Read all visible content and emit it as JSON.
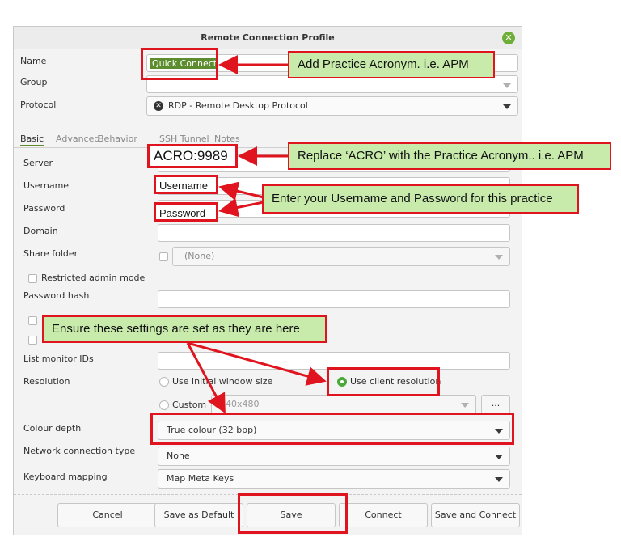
{
  "window": {
    "title": "Remote Connection Profile"
  },
  "form": {
    "name_label": "Name",
    "name_value": "Quick Connect",
    "group_label": "Group",
    "protocol_label": "Protocol",
    "protocol_value": "RDP - Remote Desktop Protocol"
  },
  "tabs": [
    "Basic",
    "Advanced",
    "Behavior",
    "SSH Tunnel",
    "Notes"
  ],
  "basic": {
    "server_label": "Server",
    "server_value": "ACRO:9989",
    "username_label": "Username",
    "username_value": "Username",
    "password_label": "Password",
    "password_value": "Password",
    "domain_label": "Domain",
    "share_label": "Share folder",
    "share_value": "(None)",
    "restricted_label": "Restricted admin mode",
    "hash_label": "Password hash",
    "monitor_label": "List monitor IDs",
    "resolution_label": "Resolution",
    "use_initial_label": "Use initial window size",
    "use_client_label": "Use client resolution",
    "custom_label": "Custom",
    "custom_value": "640x480",
    "custom_more": "...",
    "colour_label": "Colour depth",
    "colour_value": "True colour (32 bpp)",
    "network_label": "Network connection type",
    "network_value": "None",
    "keyboard_label": "Keyboard mapping",
    "keyboard_value": "Map Meta Keys"
  },
  "buttons": {
    "cancel": "Cancel",
    "save_default": "Save as Default",
    "save": "Save",
    "connect": "Connect",
    "save_connect": "Save and Connect"
  },
  "annotations": {
    "acronym": "Add Practice Acronym. i.e. APM",
    "replace": "Replace ‘ACRO’ with the Practice Acronym.. i.e. APM",
    "credentials": "Enter your Username and Password for this practice",
    "settings": "Ensure these settings are set as they are here"
  },
  "colors": {
    "accent": "#5d8c2f",
    "annotation_red": "#e0141e",
    "callout_green": "#c8ebac"
  }
}
